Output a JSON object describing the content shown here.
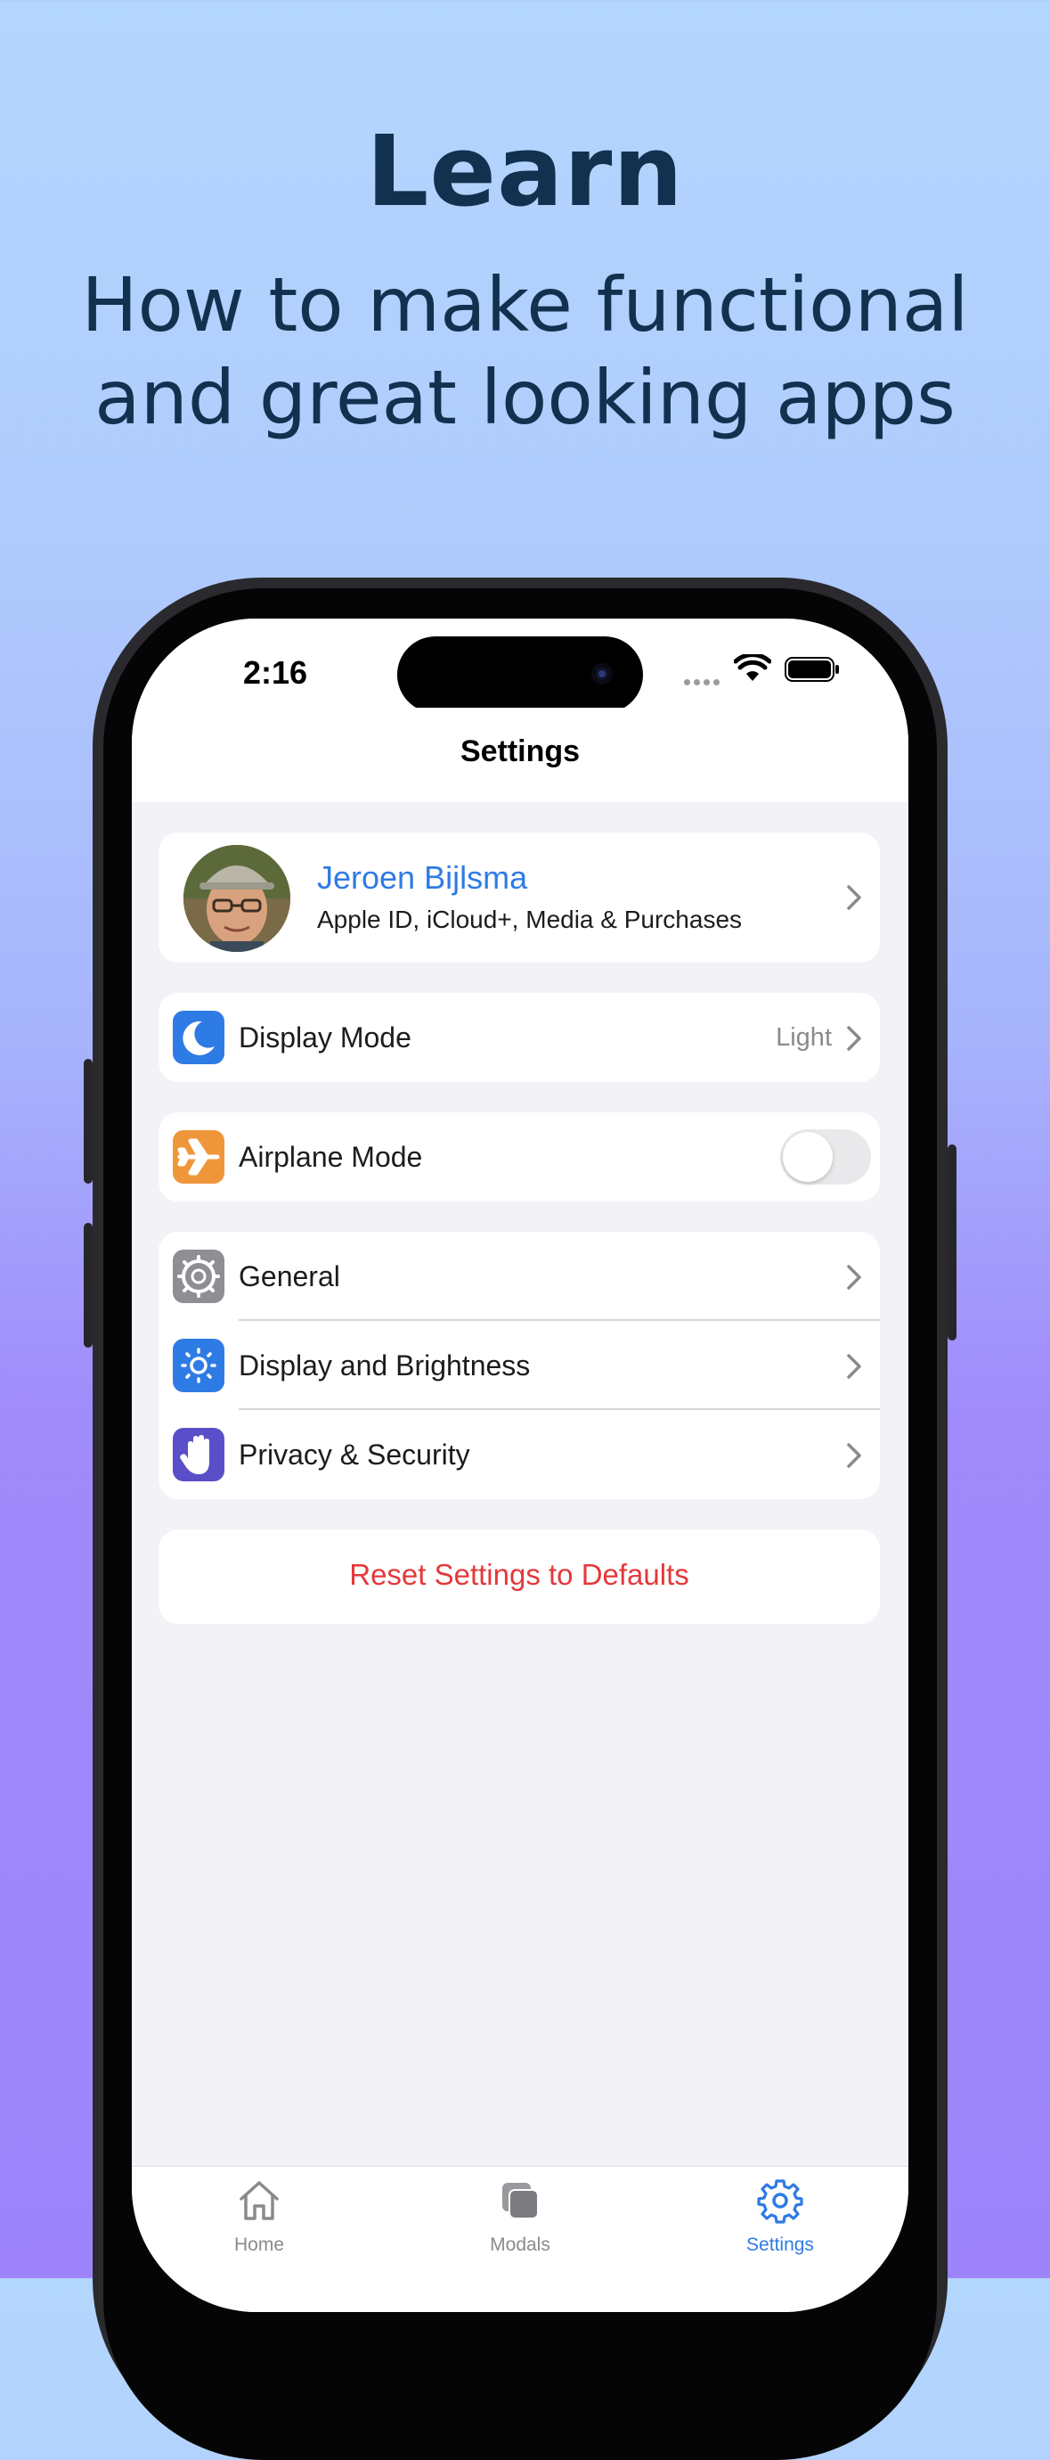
{
  "promo": {
    "headline": "Learn",
    "subhead_line1": "How to make functional",
    "subhead_line2": "and great looking apps"
  },
  "status_bar": {
    "time": "2:16"
  },
  "nav": {
    "title": "Settings"
  },
  "profile": {
    "name": "Jeroen Bijlsma",
    "subtitle": "Apple ID, iCloud+, Media & Purchases"
  },
  "display_mode": {
    "label": "Display Mode",
    "value": "Light",
    "icon": "moon-icon"
  },
  "airplane": {
    "label": "Airplane Mode",
    "enabled": false,
    "icon": "airplane-icon"
  },
  "settings_group": [
    {
      "label": "General",
      "icon": "gear-icon",
      "color": "#8e8e93"
    },
    {
      "label": "Display and Brightness",
      "icon": "sun-icon",
      "color": "#2f7be5"
    },
    {
      "label": "Privacy & Security",
      "icon": "hand-icon",
      "color": "#5b4fc9"
    }
  ],
  "reset": {
    "label": "Reset Settings to Defaults"
  },
  "tabs": [
    {
      "label": "Home",
      "icon": "house-icon",
      "active": false
    },
    {
      "label": "Modals",
      "icon": "stacked-squares-icon",
      "active": false
    },
    {
      "label": "Settings",
      "icon": "gear-icon",
      "active": true
    }
  ],
  "colors": {
    "accent": "#2f7be5",
    "destructive": "#e5383b",
    "headline": "#12314f",
    "moon_icon_bg": "#2f7be5",
    "airplane_icon_bg": "#f0963a"
  }
}
